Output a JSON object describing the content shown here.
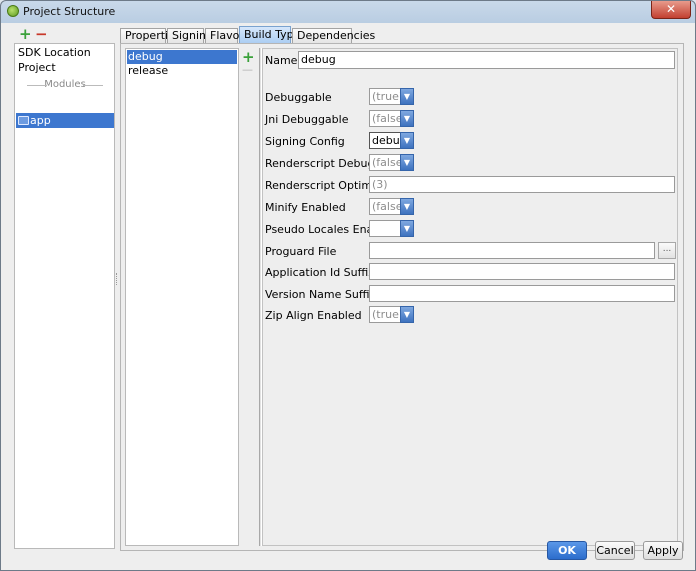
{
  "window": {
    "title": "Project Structure",
    "close_label": "✕"
  },
  "left": {
    "add_label": "+",
    "remove_label": "−",
    "items": [
      {
        "label": "SDK Location"
      },
      {
        "label": "Project"
      }
    ],
    "modules_header": "Modules",
    "module": {
      "label": "app"
    }
  },
  "tabs": [
    "Properties",
    "Signing",
    "Flavors",
    "Build Types",
    "Dependencies"
  ],
  "active_tab": "Build Types",
  "build_types": {
    "items": [
      {
        "label": "debug"
      },
      {
        "label": "release"
      }
    ],
    "selected": "debug",
    "add_label": "+",
    "remove_label": "—"
  },
  "form": {
    "name_label": "Name:",
    "name_value": "debug",
    "fields": {
      "debuggable": {
        "label": "Debuggable",
        "value": "(true)"
      },
      "jni_debuggable": {
        "label": "Jni Debuggable",
        "value": "(false)"
      },
      "signing_config": {
        "label": "Signing Config",
        "value": "debug"
      },
      "renderscript_debuggable": {
        "label": "Renderscript Debuggable",
        "value": "(false)"
      },
      "renderscript_optim_level": {
        "label": "Renderscript Optim Level",
        "value": "(3)"
      },
      "minify_enabled": {
        "label": "Minify Enabled",
        "value": "(false)"
      },
      "pseudo_locales_enabled": {
        "label": "Pseudo Locales Enabled",
        "value": ""
      },
      "proguard_file": {
        "label": "Proguard File",
        "value": "",
        "browse_label": "..."
      },
      "application_id_suffix": {
        "label": "Application Id Suffix",
        "value": ""
      },
      "version_name_suffix": {
        "label": "Version Name Suffix",
        "value": ""
      },
      "zip_align_enabled": {
        "label": "Zip Align Enabled",
        "value": "(true)"
      }
    }
  },
  "buttons": {
    "ok": "OK",
    "cancel": "Cancel",
    "apply": "Apply"
  },
  "colors": {
    "selection": "#3d77cf",
    "primary_button": "#2c6dcc",
    "add": "#3aa13a",
    "remove": "#c8382a"
  }
}
